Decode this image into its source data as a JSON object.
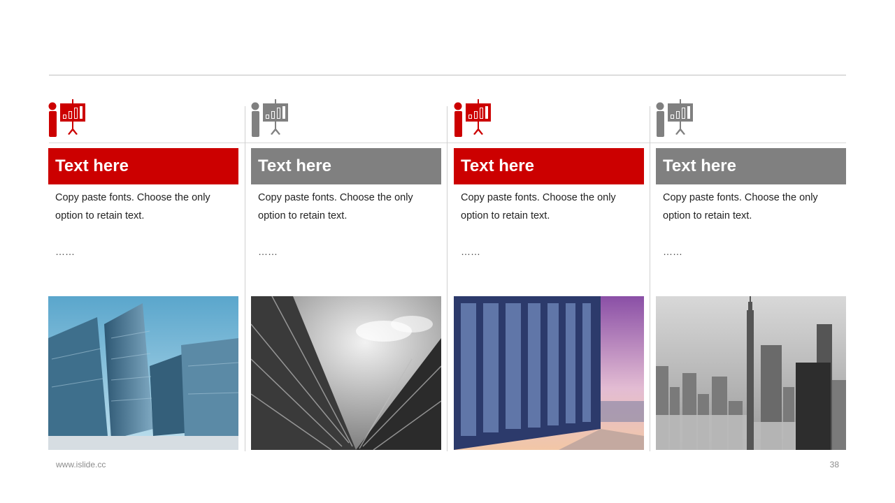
{
  "footer": {
    "url": "www.islide.cc",
    "page_number": "38"
  },
  "colors": {
    "accent": "#cc0000",
    "neutral": "#808080"
  },
  "columns": [
    {
      "header": "Text here",
      "body": "Copy paste fonts. Choose the only option to retain text.",
      "dots": "……",
      "accent": "red",
      "icon": "presenter-chart-icon",
      "photo": "glass-skyscrapers-blue"
    },
    {
      "header": "Text here",
      "body": "Copy paste fonts. Choose the only option to retain text.",
      "dots": "……",
      "accent": "gray",
      "icon": "presenter-chart-icon",
      "photo": "glass-tower-bw"
    },
    {
      "header": "Text here",
      "body": "Copy paste fonts. Choose the only option to retain text.",
      "dots": "……",
      "accent": "red",
      "icon": "presenter-chart-icon",
      "photo": "glass-facade-sunset"
    },
    {
      "header": "Text here",
      "body": "Copy paste fonts. Choose the only option to retain text.",
      "dots": "……",
      "accent": "gray",
      "icon": "presenter-chart-icon",
      "photo": "city-skyline-bw"
    }
  ]
}
